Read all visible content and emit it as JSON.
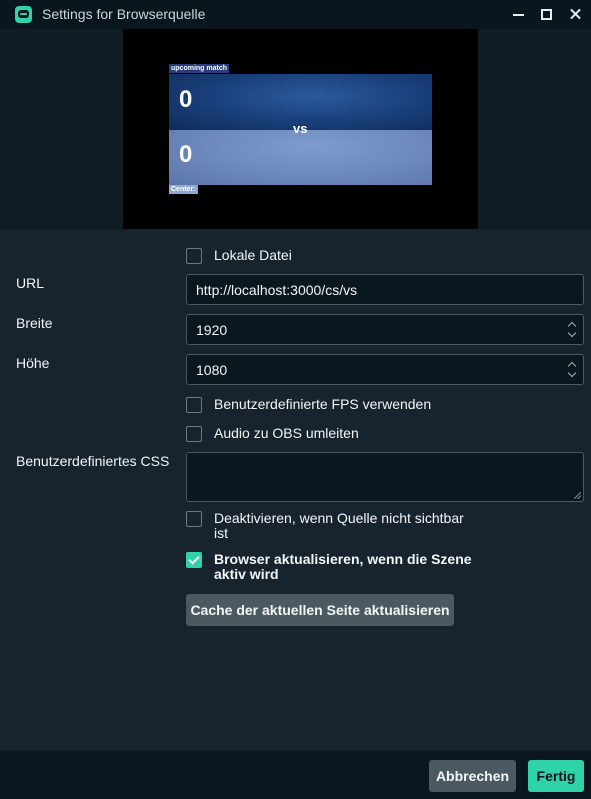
{
  "window": {
    "title": "Settings for Browserquelle",
    "icon": "streamlabs-icon",
    "controls": [
      "minimize-icon",
      "maximize-icon",
      "close-icon"
    ]
  },
  "preview": {
    "top_tag": "upcoming match",
    "score_a": "0",
    "score_b": "0",
    "vs": "vs",
    "bottom_tag": "Center:"
  },
  "form": {
    "local_file": {
      "label": "Lokale Datei",
      "checked": false
    },
    "url": {
      "label": "URL",
      "value": "http://localhost:3000/cs/vs"
    },
    "width": {
      "label": "Breite",
      "value": "1920"
    },
    "height": {
      "label": "Höhe",
      "value": "1080"
    },
    "custom_fps": {
      "label": "Benutzerdefinierte FPS verwenden",
      "checked": false
    },
    "audio_obs": {
      "label": "Audio zu OBS umleiten",
      "checked": false
    },
    "custom_css": {
      "label": "Benutzerdefiniertes CSS",
      "value": ""
    },
    "deactivate_hidden": {
      "label_line1": "Deaktivieren, wenn Quelle nicht sichtbar",
      "label_line2": "ist",
      "checked": false
    },
    "refresh_active": {
      "label_line1": "Browser aktualisieren, wenn die Szene",
      "label_line2": "aktiv wird",
      "checked": true
    },
    "refresh_cache_button": "Cache der aktuellen Seite aktualisieren"
  },
  "footer": {
    "cancel": "Abbrechen",
    "done": "Fertig"
  },
  "colors": {
    "accent": "#2fd3a9",
    "background": "#17242d",
    "titlebar": "#09161d",
    "button_secondary": "#4b5a61"
  }
}
